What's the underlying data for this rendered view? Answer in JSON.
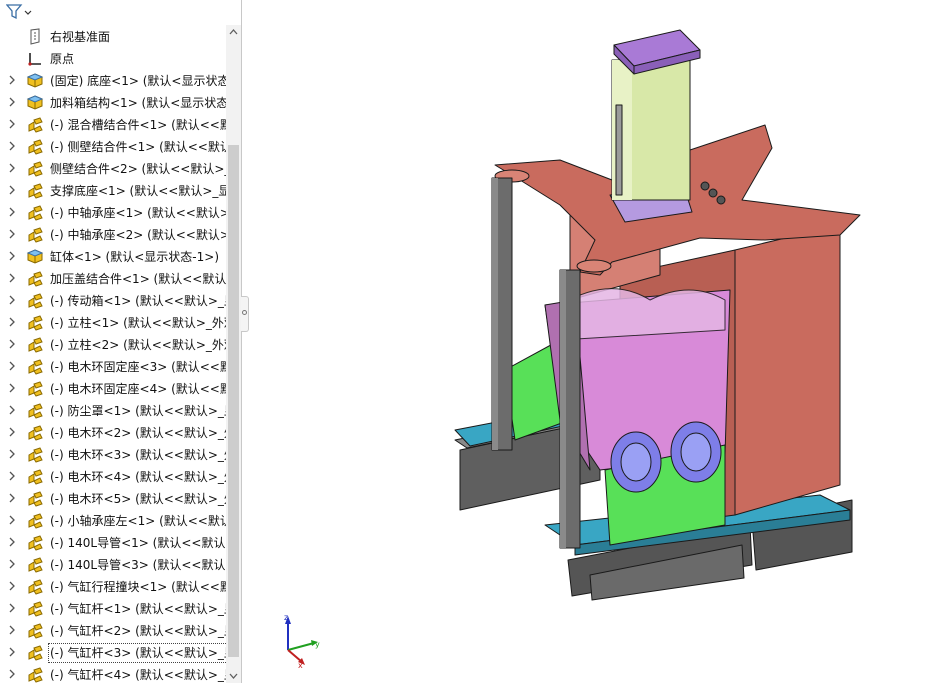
{
  "tree": {
    "rows": [
      {
        "label": "右视基准面",
        "icon": "plane-icon",
        "expandable": false
      },
      {
        "label": "原点",
        "icon": "origin-icon",
        "expandable": false
      },
      {
        "label": "(固定) 底座<1> (默认<显示状态",
        "icon": "part-icon",
        "expandable": true
      },
      {
        "label": "加料箱结构<1> (默认<显示状态",
        "icon": "part-icon",
        "expandable": true
      },
      {
        "label": "(-) 混合槽结合件<1> (默认<<默",
        "icon": "assembly-icon",
        "expandable": true
      },
      {
        "label": "(-) 侧壁结合件<1> (默认<<默认",
        "icon": "assembly-icon",
        "expandable": true
      },
      {
        "label": "侧壁结合件<2> (默认<<默认>_",
        "icon": "assembly-icon",
        "expandable": true
      },
      {
        "label": "支撑底座<1> (默认<<默认>_显",
        "icon": "assembly-icon",
        "expandable": true
      },
      {
        "label": "(-) 中轴承座<1> (默认<<默认>_",
        "icon": "assembly-icon",
        "expandable": true
      },
      {
        "label": "(-) 中轴承座<2> (默认<<默认>_",
        "icon": "assembly-icon",
        "expandable": true
      },
      {
        "label": "缸体<1> (默认<显示状态-1>)",
        "icon": "part-icon",
        "expandable": true
      },
      {
        "label": "加压盖结合件<1> (默认<<默认>",
        "icon": "assembly-icon",
        "expandable": true
      },
      {
        "label": "(-) 传动箱<1> (默认<<默认>_显",
        "icon": "assembly-icon",
        "expandable": true
      },
      {
        "label": "(-) 立柱<1> (默认<<默认>_外观",
        "icon": "assembly-icon",
        "expandable": true
      },
      {
        "label": "(-) 立柱<2> (默认<<默认>_外观",
        "icon": "assembly-icon",
        "expandable": true
      },
      {
        "label": "(-) 电木环固定座<3> (默认<<默",
        "icon": "assembly-icon",
        "expandable": true
      },
      {
        "label": "(-) 电木环固定座<4> (默认<<默",
        "icon": "assembly-icon",
        "expandable": true
      },
      {
        "label": "(-) 防尘罩<1> (默认<<默认>_显",
        "icon": "assembly-icon",
        "expandable": true
      },
      {
        "label": "(-) 电木环<2> (默认<<默认>_外",
        "icon": "assembly-icon",
        "expandable": true
      },
      {
        "label": "(-) 电木环<3> (默认<<默认>_外",
        "icon": "assembly-icon",
        "expandable": true
      },
      {
        "label": "(-) 电木环<4> (默认<<默认>_外",
        "icon": "assembly-icon",
        "expandable": true
      },
      {
        "label": "(-) 电木环<5> (默认<<默认>_外",
        "icon": "assembly-icon",
        "expandable": true
      },
      {
        "label": "(-) 小轴承座左<1> (默认<<默认",
        "icon": "assembly-icon",
        "expandable": true
      },
      {
        "label": "(-) 140L导管<1> (默认<<默认>_",
        "icon": "assembly-icon",
        "expandable": true
      },
      {
        "label": "(-) 140L导管<3> (默认<<默认>_",
        "icon": "assembly-icon",
        "expandable": true
      },
      {
        "label": "(-) 气缸行程撞块<1> (默认<<默",
        "icon": "assembly-icon",
        "expandable": true
      },
      {
        "label": "(-) 气缸杆<1> (默认<<默认>_显",
        "icon": "assembly-icon",
        "expandable": true
      },
      {
        "label": "(-) 气缸杆<2> (默认<<默认>_显",
        "icon": "assembly-icon",
        "expandable": true
      },
      {
        "label": "(-) 气缸杆<3> (默认<<默认>_显",
        "icon": "assembly-icon",
        "expandable": true,
        "selected": true
      },
      {
        "label": "(-) 气缸杆<4> (默认<<默认>_显",
        "icon": "assembly-icon",
        "expandable": true
      }
    ]
  },
  "triad": {
    "x_label": "x",
    "y_label": "y",
    "z_label": "z"
  },
  "colors": {
    "base_gray": "#5f5f5f",
    "plate_cyan": "#39a6c4",
    "frame_red": "#c96b5e",
    "chamber_pink": "#d88ad8",
    "cylinder_green": "#d8e8a8",
    "cap_purple": "#a97ad6",
    "bearing_green": "#58e058",
    "ring_blue": "#7e7ee8",
    "column_gray": "#6c6c6c",
    "tree_yellow": "#f0c020"
  }
}
